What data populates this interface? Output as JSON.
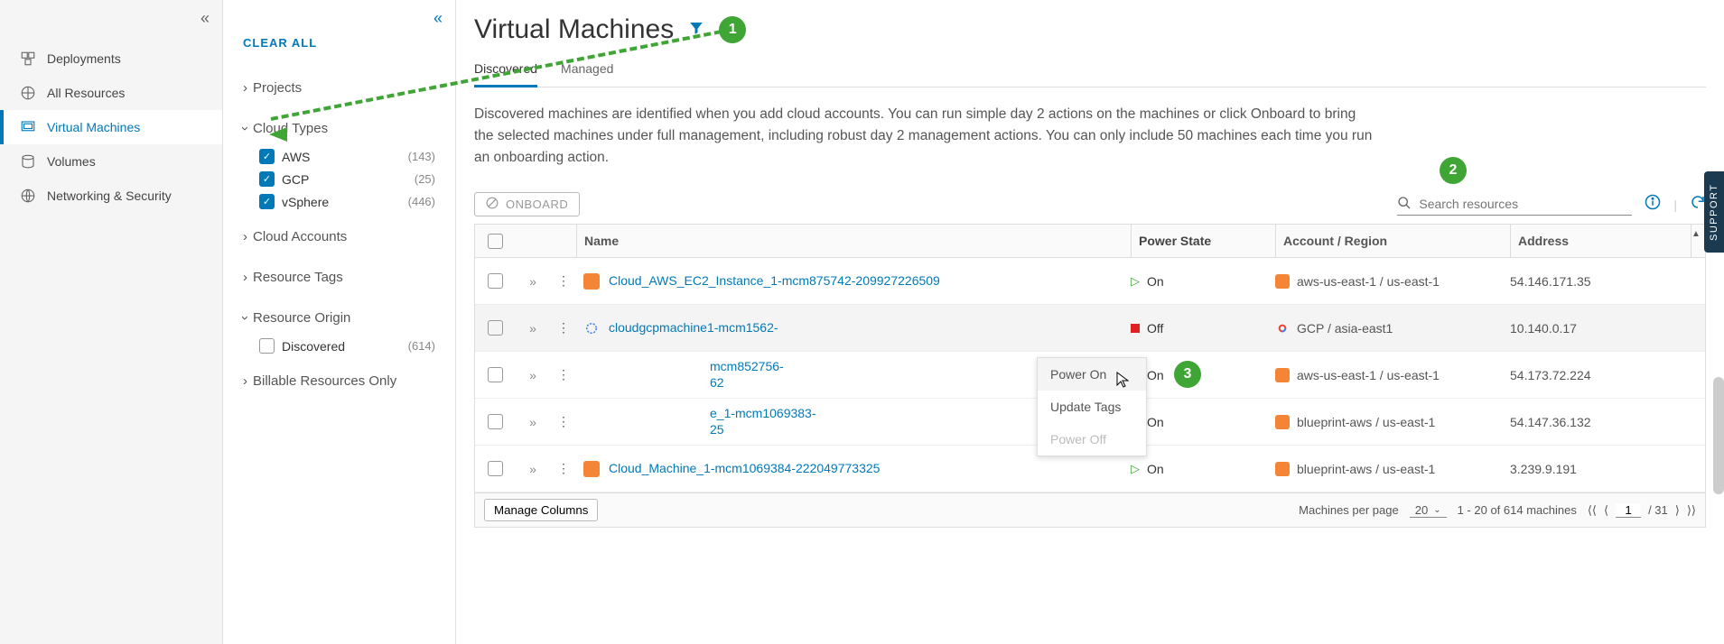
{
  "leftnav": {
    "items": [
      {
        "label": "Deployments"
      },
      {
        "label": "All Resources"
      },
      {
        "label": "Virtual Machines"
      },
      {
        "label": "Volumes"
      },
      {
        "label": "Networking & Security"
      }
    ],
    "active_index": 2
  },
  "filters": {
    "clear_all": "CLEAR ALL",
    "groups": {
      "projects": {
        "label": "Projects",
        "expanded": false
      },
      "cloud_types": {
        "label": "Cloud Types",
        "expanded": true,
        "items": [
          {
            "label": "AWS",
            "count": "(143)",
            "checked": true
          },
          {
            "label": "GCP",
            "count": "(25)",
            "checked": true
          },
          {
            "label": "vSphere",
            "count": "(446)",
            "checked": true
          }
        ]
      },
      "cloud_accounts": {
        "label": "Cloud Accounts",
        "expanded": false
      },
      "resource_tags": {
        "label": "Resource Tags",
        "expanded": false
      },
      "resource_origin": {
        "label": "Resource Origin",
        "expanded": true,
        "items": [
          {
            "label": "Discovered",
            "count": "(614)",
            "checked": false
          }
        ]
      },
      "billable": {
        "label": "Billable Resources Only",
        "expanded": false
      }
    }
  },
  "page": {
    "title": "Virtual Machines",
    "tabs": [
      {
        "label": "Discovered",
        "active": true
      },
      {
        "label": "Managed",
        "active": false
      }
    ],
    "description": "Discovered machines are identified when you add cloud accounts. You can run simple day 2 actions on the machines or click Onboard to bring the selected machines under full management, including robust day 2 management actions. You can only include 50 machines each time you run an onboarding action.",
    "onboard_label": "ONBOARD",
    "search_placeholder": "Search resources",
    "annotation_badges": {
      "filter": "1",
      "search": "2",
      "menu": "3"
    },
    "support_label": "SUPPORT"
  },
  "table": {
    "columns": {
      "name": "Name",
      "power": "Power State",
      "account": "Account / Region",
      "address": "Address"
    },
    "rows": [
      {
        "name": "Cloud_AWS_EC2_Instance_1-mcm875742-209927226509",
        "power": "On",
        "account": "aws-us-east-1 / us-east-1",
        "address": "54.146.171.35",
        "cloud": "aws"
      },
      {
        "name": "cloudgcpmachine1-mcm1562-",
        "power": "Off",
        "account": "GCP / asia-east1",
        "address": "10.140.0.17",
        "cloud": "gcp",
        "hover": true
      },
      {
        "name": "mcm852756-",
        "power": "On",
        "account": "aws-us-east-1 / us-east-1",
        "address": "54.173.72.224",
        "cloud": "aws",
        "partial": true,
        "suffix": "62"
      },
      {
        "name": "e_1-mcm1069383-",
        "power": "On",
        "account": "blueprint-aws / us-east-1",
        "address": "54.147.36.132",
        "cloud": "aws",
        "partial": true,
        "suffix": "25"
      },
      {
        "name": "Cloud_Machine_1-mcm1069384-222049773325",
        "power": "On",
        "account": "blueprint-aws / us-east-1",
        "address": "3.239.9.191",
        "cloud": "aws"
      }
    ],
    "context_menu": {
      "power_on": "Power On",
      "update_tags": "Update Tags",
      "power_off": "Power Off"
    },
    "footer": {
      "manage_columns": "Manage Columns",
      "per_page_label": "Machines per page",
      "per_page_value": "20",
      "range": "1 - 20 of 614 machines",
      "page_current": "1",
      "page_total": "/ 31"
    }
  }
}
